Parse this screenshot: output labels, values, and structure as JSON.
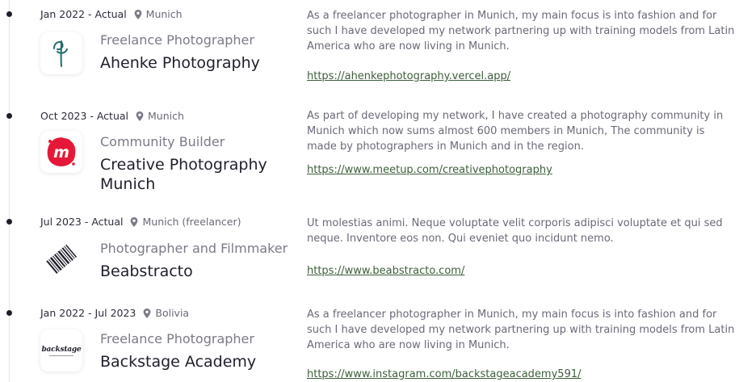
{
  "entries": [
    {
      "period": "Jan 2022 - Actual",
      "location": "Munich",
      "role": "Freelance Photographer",
      "company": "Ahenke Photography",
      "logo_icon": "ahenke-monogram-logo",
      "description": "As a freelancer photographer in Munich, my main focus is into fashion and for such I have developed my network partnering up with training models from Latin America who are now living in Munich.",
      "link": "https://ahenkephotography.vercel.app/"
    },
    {
      "period": "Oct 2023 - Actual",
      "location": "Munich",
      "role": "Community Builder",
      "company": "Creative Photography Munich",
      "logo_icon": "meetup-logo",
      "description": "As part of developing my network, I have created a photography community in Munich which now sums almost 600 members in Munich, The community is made by photographers in Munich and in the region.",
      "link": "https://www.meetup.com/creativephotography"
    },
    {
      "period": "Jul 2023 - Actual",
      "location": "Munich (freelancer)",
      "role": "Photographer and Filmmaker",
      "company": "Beabstracto",
      "logo_icon": "beabstracto-barcode-logo",
      "description": "Ut molestias animi. Neque voluptate velit corporis adipisci voluptate et qui sed neque. Inventore eos non. Qui eveniet quo incidunt nemo.",
      "link": "https://www.beabstracto.com/"
    },
    {
      "period": "Jan 2022 - Jul 2023",
      "location": "Bolivia",
      "role": "Freelance Photographer",
      "company": "Backstage Academy",
      "logo_icon": "backstage-wordmark-logo",
      "logo_text": "backstage",
      "description": "As a freelancer photographer in Munich, my main focus is into fashion and for such I have developed my network partnering up with training models from Latin America who are now living in Munich.",
      "link": "https://www.instagram.com/backstageacademy591/"
    }
  ],
  "colors": {
    "link": "#3e5e3b",
    "meetup_red": "#e51937",
    "ahenke_teal": "#1f6b6b"
  }
}
